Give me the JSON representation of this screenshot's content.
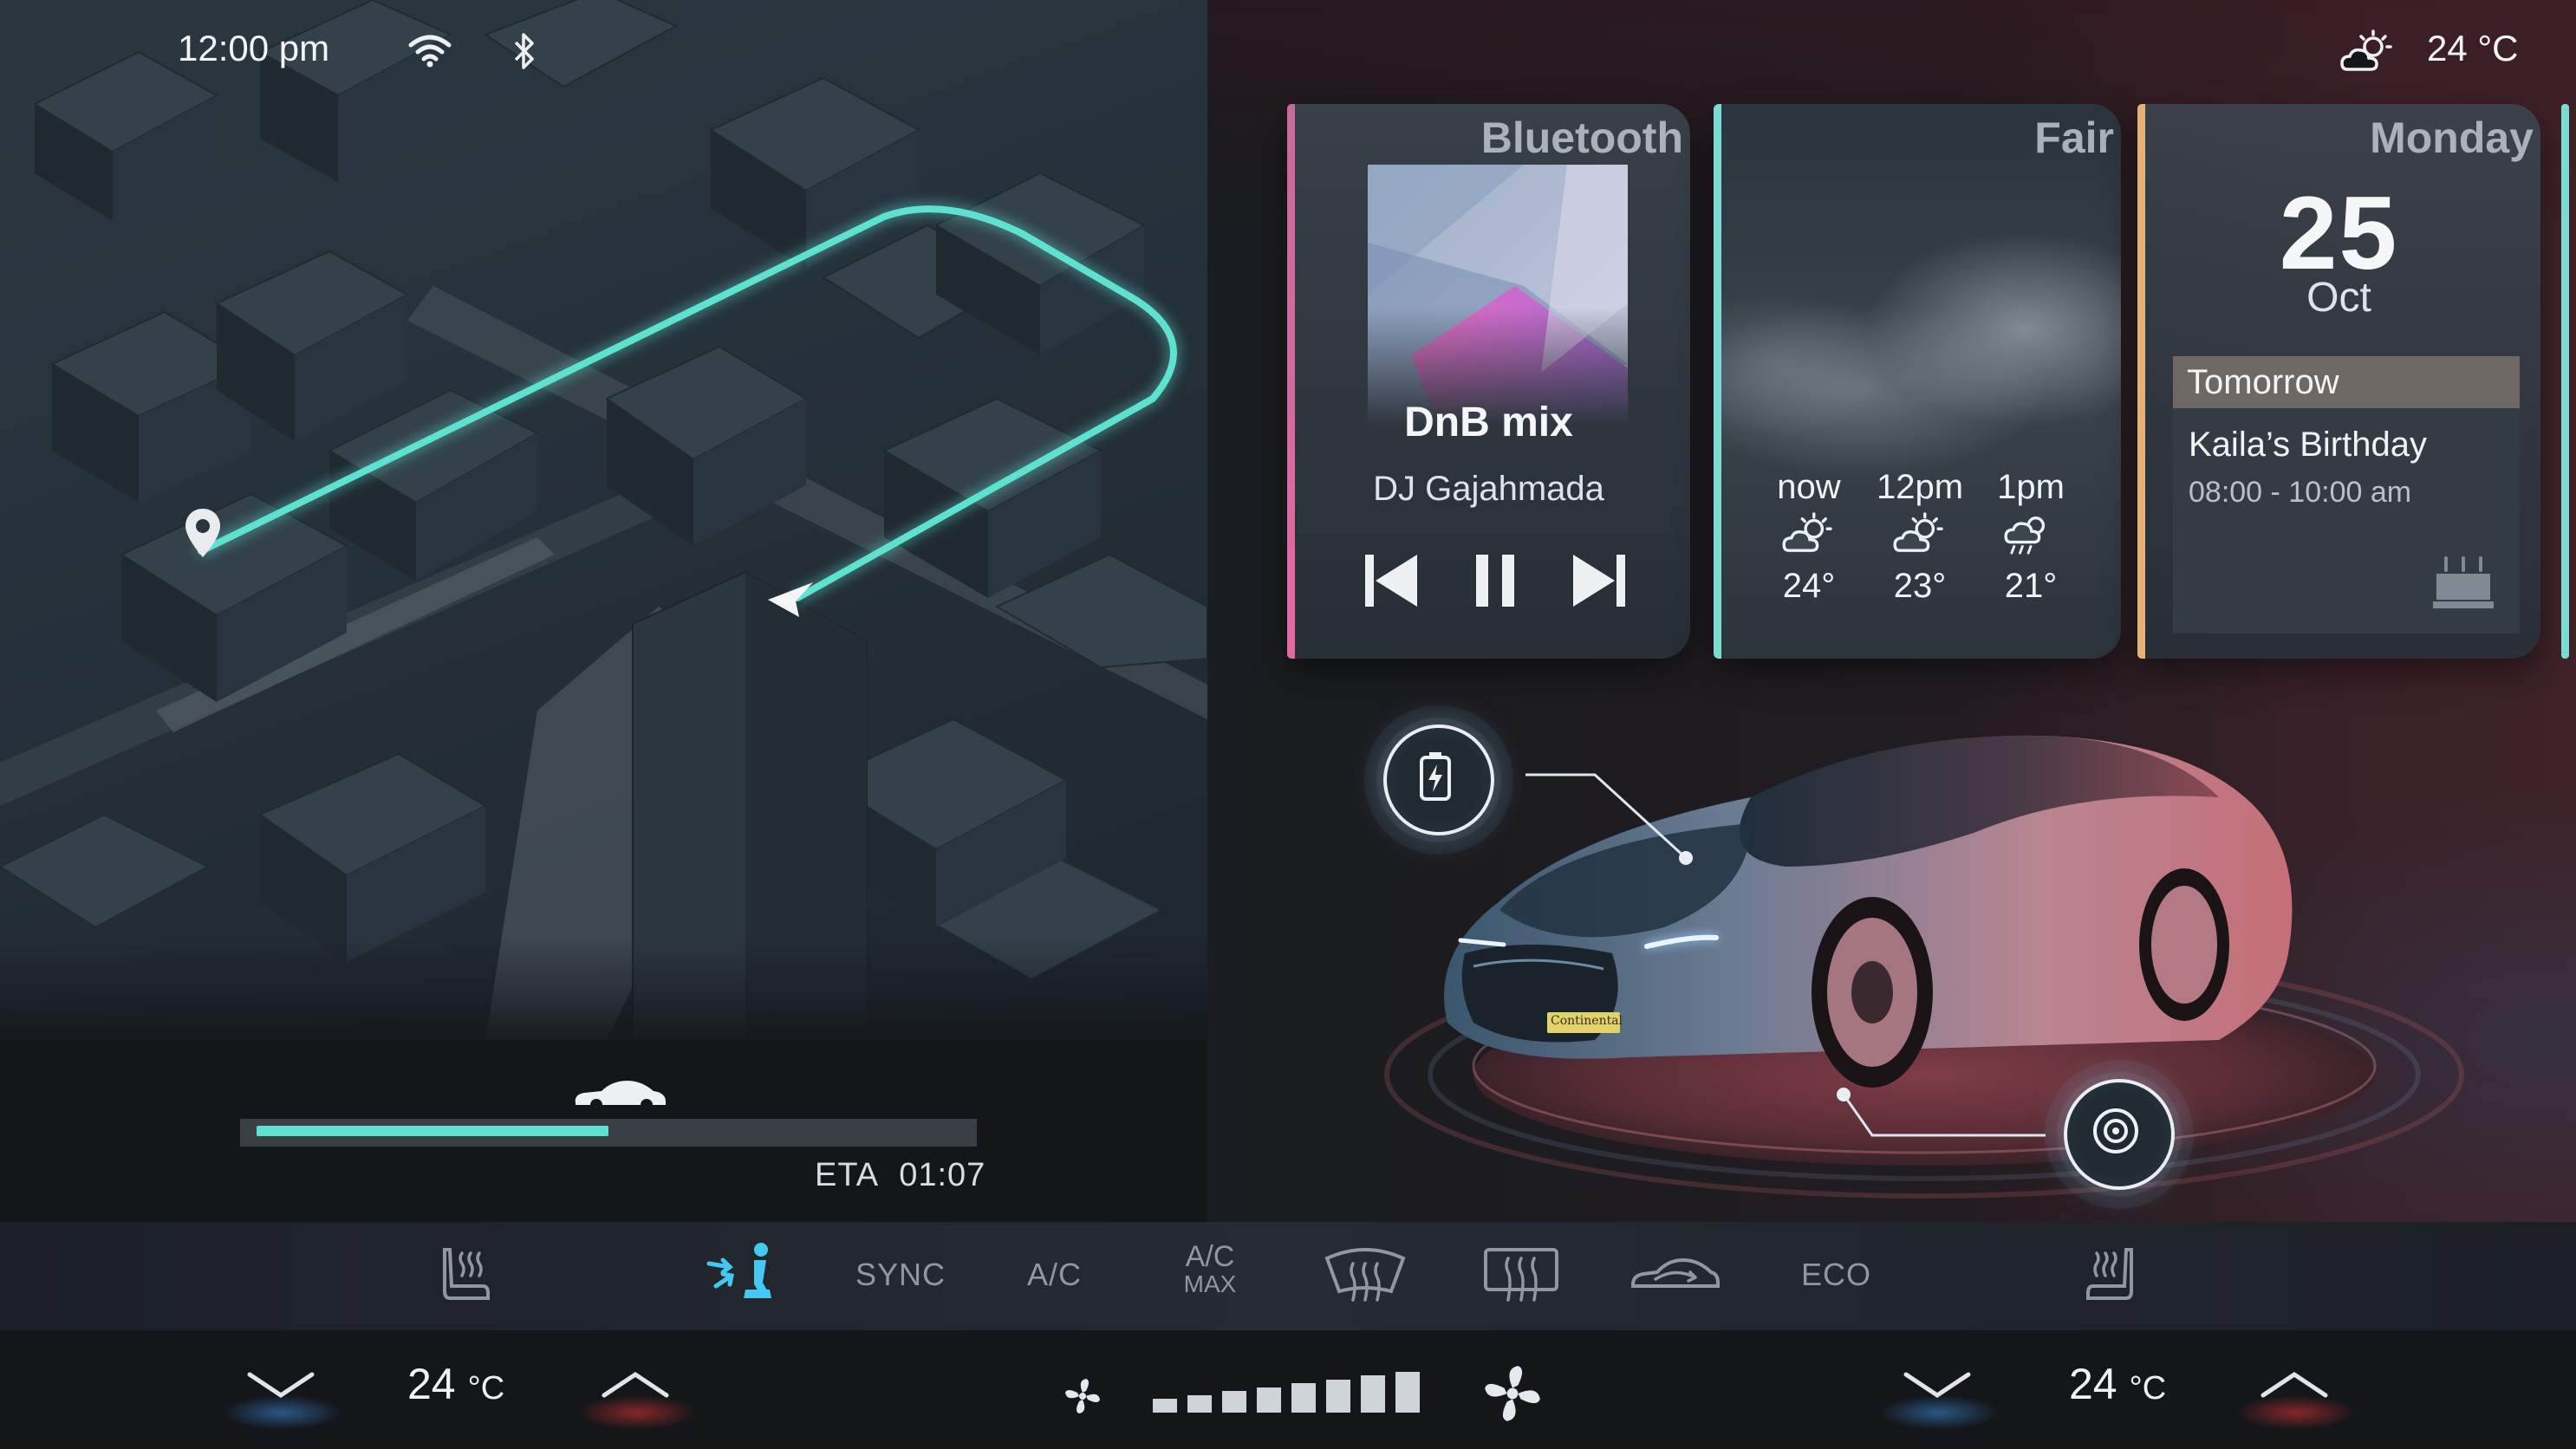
{
  "status_bar": {
    "time": "12:00 pm",
    "wifi_icon": "wifi-icon",
    "bluetooth_icon": "bluetooth-icon",
    "weather_icon": "partly-cloudy-icon",
    "outside_temp": "24 °C"
  },
  "navigation": {
    "route_color": "#5fe1d0",
    "eta_label": "ETA",
    "eta_value": "01:07",
    "progress": 0.5
  },
  "cards": {
    "music": {
      "title": "Bluetooth",
      "accent": "#e06aa0",
      "track": "DnB mix",
      "artist": "DJ Gajahmada",
      "controls": [
        "previous-track-icon",
        "pause-icon",
        "next-track-icon"
      ]
    },
    "weather": {
      "title": "Fair",
      "accent": "#7bdbd0",
      "forecast": [
        {
          "time": "now",
          "icon": "partly-cloudy-icon",
          "temp": "24°"
        },
        {
          "time": "12pm",
          "icon": "partly-cloudy-icon",
          "temp": "23°"
        },
        {
          "time": "1pm",
          "icon": "rain-icon",
          "temp": "21°"
        }
      ]
    },
    "calendar": {
      "title": "Monday",
      "accent": "#e7b27a",
      "day": "25",
      "month": "Oct",
      "event_header": "Tomorrow",
      "event_title": "Kaila’s Birthday",
      "event_time": "08:00 - 10:00 am",
      "event_icon": "birthday-cake-icon"
    }
  },
  "vehicle": {
    "battery_icon": "battery-charging-icon",
    "tire_icon": "tire-icon",
    "plate": "Continental"
  },
  "climate": {
    "buttons": {
      "sync": "SYNC",
      "ac": "A/C",
      "ac_max_top": "A/C",
      "ac_max_bottom": "MAX",
      "eco": "ECO"
    },
    "active_color": "#45c8f0",
    "left_temp": "24",
    "right_temp": "24",
    "temp_unit": "°C",
    "fan_level": 8,
    "fan_max": 8
  }
}
